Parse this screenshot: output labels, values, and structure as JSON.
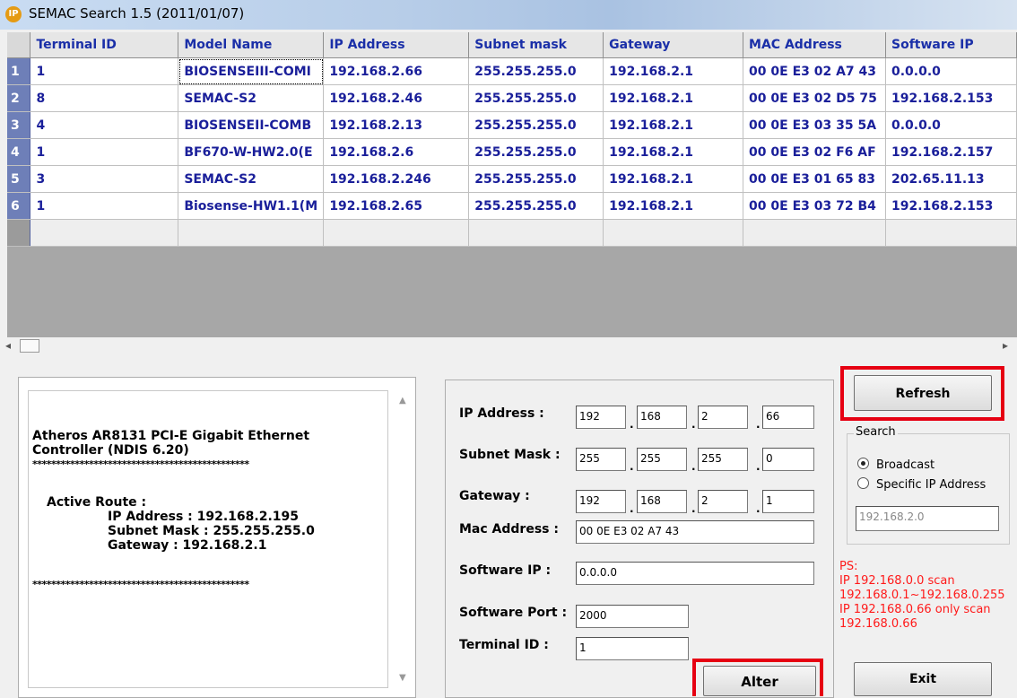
{
  "window": {
    "title": "SEMAC Search 1.5 (2011/01/07)",
    "icon_text": "IP",
    "icon": "app-ip-icon"
  },
  "grid": {
    "columns": [
      "Terminal ID",
      "Model Name",
      "IP Address",
      "Subnet mask",
      "Gateway",
      "MAC Address",
      "Software IP"
    ],
    "rows": [
      {
        "num": "1",
        "cells": [
          "1",
          "BIOSENSEIII-COMI",
          "192.168.2.66",
          "255.255.255.0",
          "192.168.2.1",
          "00 0E E3 02 A7 43",
          "0.0.0.0"
        ]
      },
      {
        "num": "2",
        "cells": [
          "8",
          "SEMAC-S2",
          "192.168.2.46",
          "255.255.255.0",
          "192.168.2.1",
          "00 0E E3 02 D5 75",
          "192.168.2.153"
        ]
      },
      {
        "num": "3",
        "cells": [
          "4",
          "BIOSENSEII-COMB",
          "192.168.2.13",
          "255.255.255.0",
          "192.168.2.1",
          "00 0E E3 03 35 5A",
          "0.0.0.0"
        ]
      },
      {
        "num": "4",
        "cells": [
          "1",
          "BF670-W-HW2.0(E",
          "192.168.2.6",
          "255.255.255.0",
          "192.168.2.1",
          "00 0E E3 02 F6 AF",
          "192.168.2.157"
        ]
      },
      {
        "num": "5",
        "cells": [
          "3",
          "SEMAC-S2",
          "192.168.2.246",
          "255.255.255.0",
          "192.168.2.1",
          "00 0E E3 01 65 83",
          "202.65.11.13"
        ]
      },
      {
        "num": "6",
        "cells": [
          "1",
          "Biosense-HW1.1(M",
          "192.168.2.65",
          "255.255.255.0",
          "192.168.2.1",
          "00 0E E3 03 72 B4",
          "192.168.2.153"
        ]
      }
    ]
  },
  "info": {
    "adapter_line1": "Atheros AR8131 PCI-E Gigabit Ethernet",
    "adapter_line2": "Controller (NDIS 6.20)",
    "separator": "**********************************************",
    "active_route_label": "Active Route :",
    "ip_line": "IP Address : 192.168.2.195",
    "mask_line": "Subnet Mask : 255.255.255.0",
    "gateway_line": "Gateway : 192.168.2.1"
  },
  "form": {
    "ip_label": "IP Address :",
    "ip": [
      "192",
      "168",
      "2",
      "66"
    ],
    "mask_label": "Subnet Mask :",
    "mask": [
      "255",
      "255",
      "255",
      "0"
    ],
    "gateway_label": "Gateway :",
    "gateway": [
      "192",
      "168",
      "2",
      "1"
    ],
    "mac_label": "Mac Address :",
    "mac": "00 0E E3 02 A7 43",
    "software_ip_label": "Software IP :",
    "software_ip": "0.0.0.0",
    "software_port_label": "Software Port :",
    "software_port": "2000",
    "terminal_id_label": "Terminal ID :",
    "terminal_id": "1",
    "alter_label": "Alter"
  },
  "search": {
    "refresh_label": "Refresh",
    "group_label": "Search",
    "broadcast_label": "Broadcast",
    "specific_label": "Specific IP Address",
    "specific_ip": "192.168.2.0",
    "selected": "Broadcast"
  },
  "ps": {
    "line1": "PS:",
    "line2": "IP 192.168.0.0 scan",
    "line3": "192.168.0.1~192.168.0.255",
    "line4": "IP 192.168.0.66 only scan",
    "line5": "192.168.0.66"
  },
  "exit_label": "Exit",
  "colors": {
    "highlight": "#e60012",
    "grid_text": "#1a1f9a",
    "header_text": "#1a2fa8",
    "ps_text": "#ff1a1a"
  }
}
